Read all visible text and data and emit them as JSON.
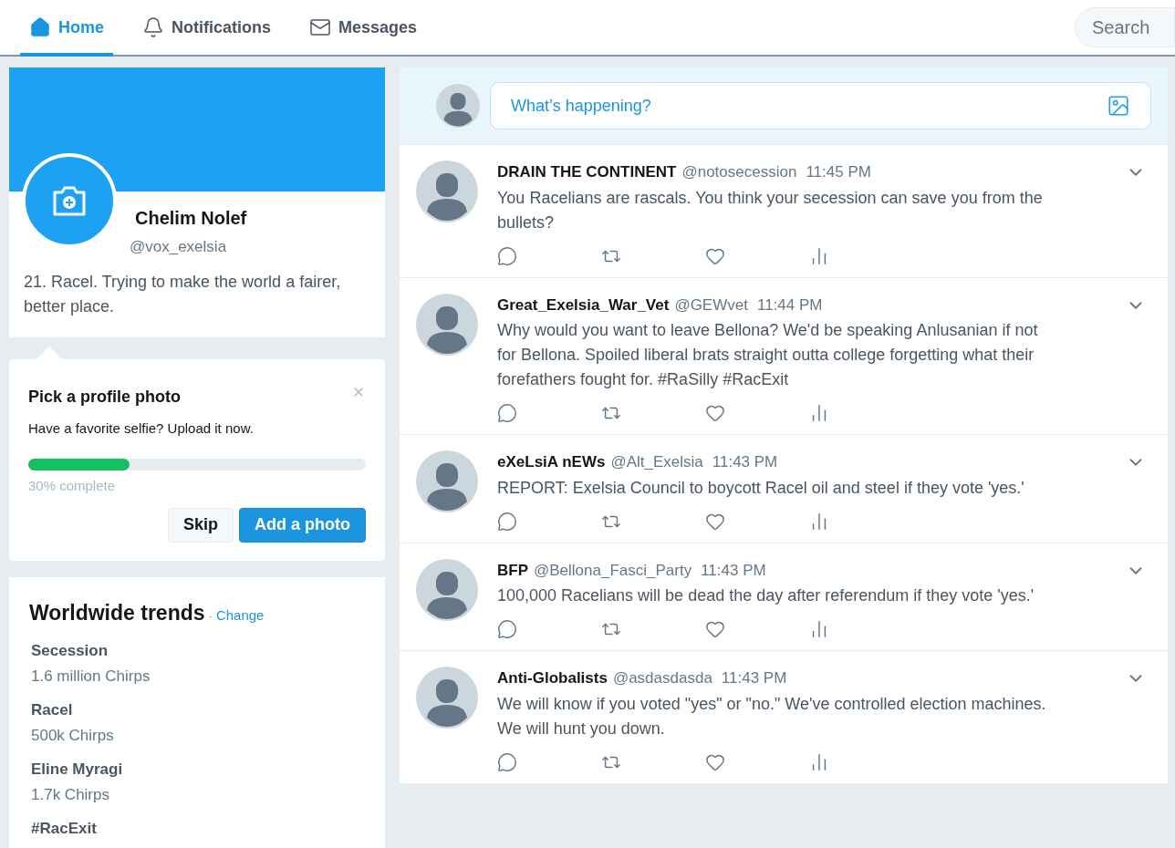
{
  "nav": {
    "tabs": [
      {
        "label": "Home",
        "selected": true
      },
      {
        "label": "Notifications",
        "selected": false
      },
      {
        "label": "Messages",
        "selected": false
      }
    ],
    "search": {
      "placeholder": "Search"
    }
  },
  "profile": {
    "name": "Chelim Nolef",
    "handle": "@vox_exelsia",
    "bio": "21. Racel. Trying to make the world a fairer, better place."
  },
  "prompt": {
    "title": "Pick a profile photo",
    "text": "Have a favorite selfie? Upload it now.",
    "level": 0.3,
    "progress_label": "30% complete",
    "buttons": [
      {
        "label": "Skip",
        "kind": "secondary"
      },
      {
        "label": "Add a photo",
        "kind": "primary"
      }
    ]
  },
  "trends": {
    "title": "Worldwide trends",
    "separator": "·",
    "change": "Change",
    "items": [
      {
        "name": "Secession",
        "count": "1.6 million Chirps"
      },
      {
        "name": "Racel",
        "count": "500k Chirps"
      },
      {
        "name": "Eline Myragi",
        "count": "1.7k Chirps"
      },
      {
        "name": "#RacExit"
      }
    ]
  },
  "compose": {
    "placeholder": "What’s happening?"
  },
  "tweets": [
    {
      "name": "DRAIN THE CONTINENT",
      "handle": "@notosecession",
      "time": "11:45 PM",
      "text": "You Racelians are rascals. You think your secession can save you from the bullets?"
    },
    {
      "name": "Great_Exelsia_War_Vet",
      "handle": "@GEWvet",
      "time": "11:44 PM",
      "text": "Why would you want to leave Bellona? We'd be speaking Anlusanian if not for Bellona. Spoiled liberal brats straight outta college forgetting what their forefathers fought for. #RaSilly #RacExit"
    },
    {
      "name": "eXeLsiA nEWs",
      "handle": "@Alt_Exelsia",
      "time": "11:43 PM",
      "text": "REPORT: Exelsia Council to boycott Racel oil and steel if they vote 'yes.'"
    },
    {
      "name": "BFP",
      "handle": "@Bellona_Fasci_Party",
      "time": "11:43 PM",
      "text": "100,000 Racelians will be dead the day after referendum if they vote 'yes.'"
    },
    {
      "name": "Anti-Globalists",
      "handle": "@asdasdasda",
      "time": "11:43 PM",
      "text": "We will know if you voted \"yes\" or \"no.\" We've controlled election machines. We will hunt you down."
    }
  ]
}
